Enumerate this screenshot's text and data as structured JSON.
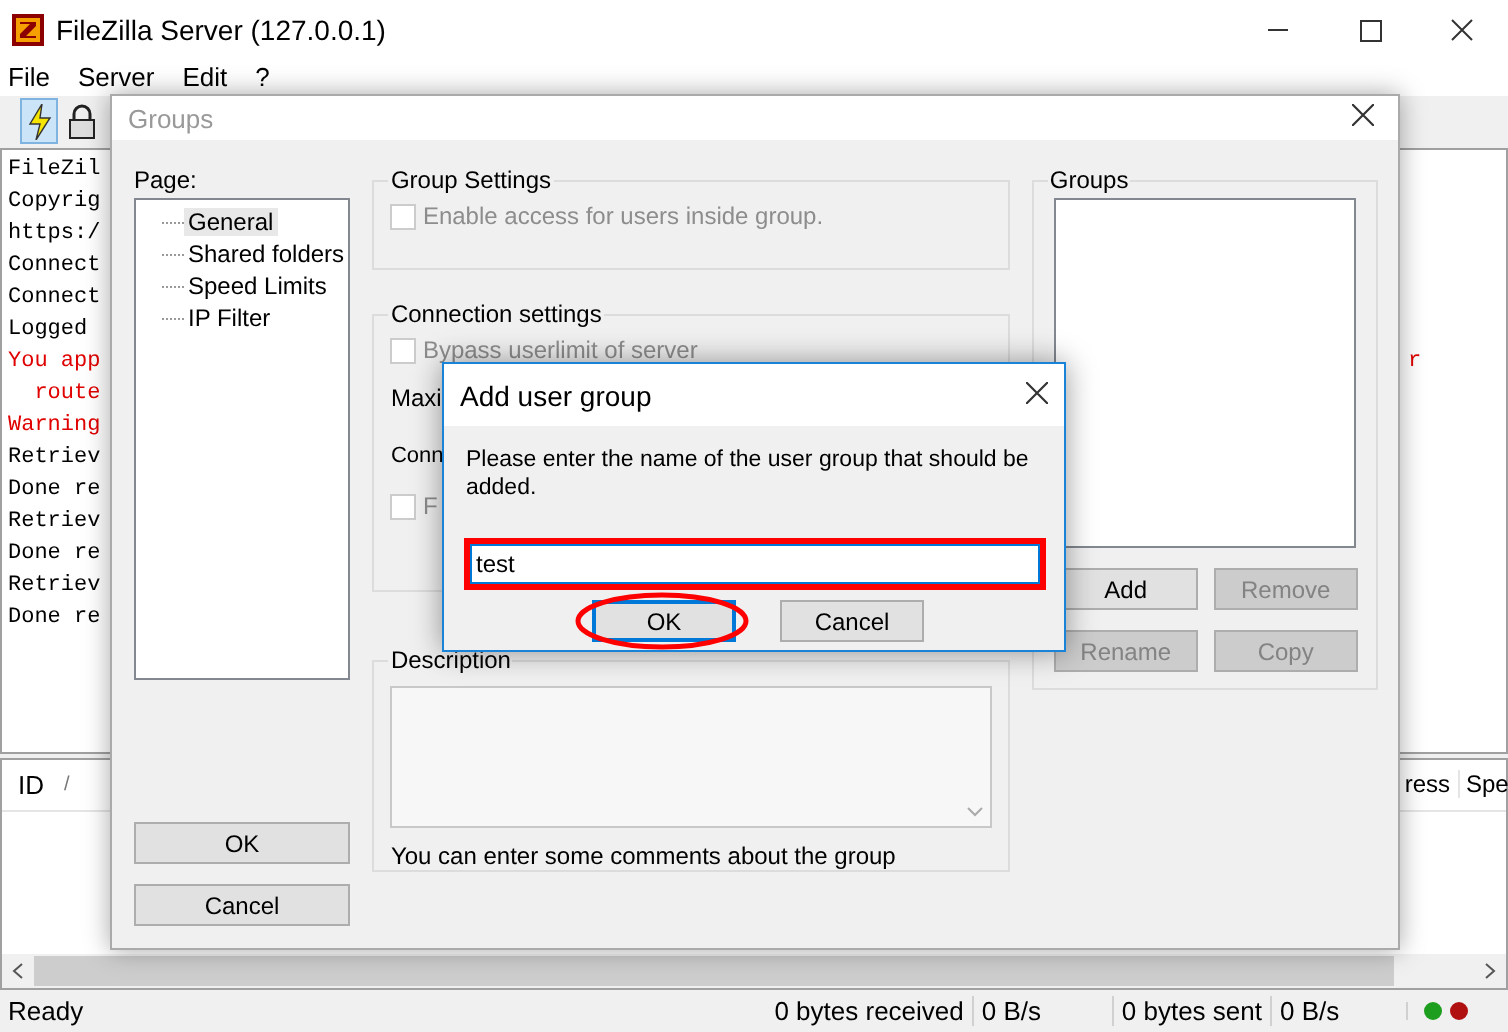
{
  "window": {
    "title": "FileZilla Server (127.0.0.1)"
  },
  "menu": [
    "File",
    "Server",
    "Edit",
    "?"
  ],
  "toolbar": [
    {
      "kind": "lightning",
      "selected": true
    },
    {
      "kind": "lock",
      "selected": false
    }
  ],
  "log": [
    {
      "text": "FileZil",
      "kind": "info"
    },
    {
      "text": "Copyrig",
      "kind": "info"
    },
    {
      "text": "https:/",
      "kind": "info"
    },
    {
      "text": "Connect",
      "kind": "info"
    },
    {
      "text": "Connect",
      "kind": "info"
    },
    {
      "text": "Logged",
      "kind": "info"
    },
    {
      "text": "You app",
      "kind": "error",
      "tail": "r"
    },
    {
      "text": "  route",
      "kind": "error"
    },
    {
      "text": "Warning",
      "kind": "error"
    },
    {
      "text": "Retriev",
      "kind": "info"
    },
    {
      "text": "Done re",
      "kind": "info"
    },
    {
      "text": "Retriev",
      "kind": "info"
    },
    {
      "text": "Done re",
      "kind": "info"
    },
    {
      "text": "Retriev",
      "kind": "info"
    },
    {
      "text": "Done re",
      "kind": "info"
    }
  ],
  "sessions": {
    "columns": [
      "ID",
      "ress",
      "Spe"
    ],
    "sort_mark": "/"
  },
  "status_bar": {
    "state": "Ready",
    "received": "0 bytes received",
    "received_rate": "0 B/s",
    "sent": "0 bytes sent",
    "sent_rate": "0 B/s",
    "lights": [
      {
        "color": "#1e9e1e"
      },
      {
        "color": "#b01010"
      }
    ]
  },
  "groups_dialog": {
    "title": "Groups",
    "page_label": "Page:",
    "pages": [
      {
        "label": "General",
        "selected": true
      },
      {
        "label": "Shared folders",
        "selected": false
      },
      {
        "label": "Speed Limits",
        "selected": false
      },
      {
        "label": "IP Filter",
        "selected": false
      }
    ],
    "group_settings": {
      "title": "Group Settings",
      "checkboxes": [
        {
          "label": "Enable access for users inside group.",
          "checked": false,
          "disabled": true
        }
      ]
    },
    "connection_settings": {
      "title": "Connection settings",
      "bypass": {
        "label": "Bypass userlimit of server",
        "checked": false,
        "disabled": true
      },
      "max_label": "Maxi",
      "conn_label": "Conn",
      "fo": {
        "label": "F",
        "checked": false,
        "disabled": true
      }
    },
    "description": {
      "title": "Description",
      "hint": "You can enter some comments about the group"
    },
    "groups": {
      "title": "Groups",
      "buttons": [
        {
          "label": "Add",
          "disabled": false
        },
        {
          "label": "Remove",
          "disabled": true
        },
        {
          "label": "Rename",
          "disabled": true
        },
        {
          "label": "Copy",
          "disabled": true
        }
      ]
    },
    "buttons": [
      "OK",
      "Cancel"
    ]
  },
  "add_dialog": {
    "title": "Add user group",
    "message": "Please enter the name of the user group that should be added.",
    "input": {
      "value": "test",
      "highlighted": true
    },
    "buttons": [
      {
        "label": "OK",
        "default": true,
        "highlighted": true
      },
      {
        "label": "Cancel",
        "default": false,
        "highlighted": false
      }
    ]
  }
}
